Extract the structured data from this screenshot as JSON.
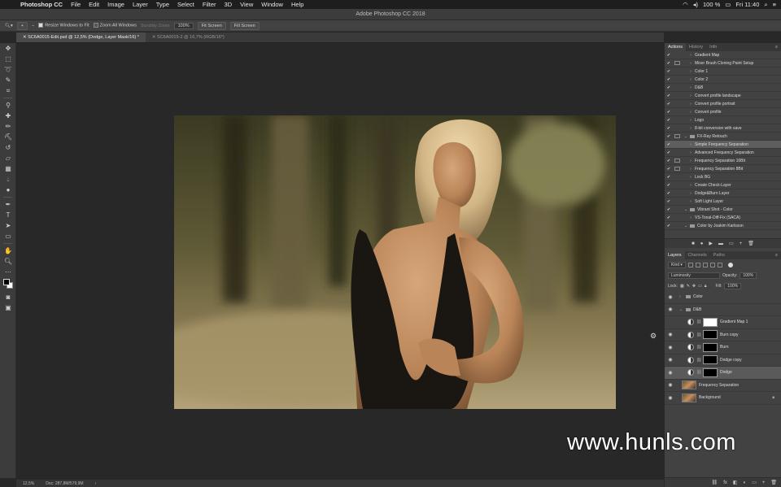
{
  "menubar": {
    "items": [
      "Photoshop CC",
      "File",
      "Edit",
      "Image",
      "Layer",
      "Type",
      "Select",
      "Filter",
      "3D",
      "View",
      "Window",
      "Help"
    ],
    "battery": "100 %",
    "clock": "Fri 11:40"
  },
  "window": {
    "title": "Adobe Photoshop CC 2018"
  },
  "options": {
    "resize_windows": "Resize Windows to Fit",
    "zoom_all": "Zoom All Windows",
    "scrubby_zoom": "Scrubby Zoom",
    "zoom_value": "100%",
    "fit_screen": "Fit Screen",
    "fill_screen": "Fill Screen"
  },
  "tabs": [
    {
      "label": "SC6A0015-Edit.psd @ 12,5% (Dodge, Layer Mask/16) *"
    },
    {
      "label": "SC6A0015-2 @ 16,7% (RGB/16*)"
    }
  ],
  "status": {
    "zoom": "12,5%",
    "doc": "Doc: 287,8M/579,9M"
  },
  "actions_panel": {
    "tabs": [
      "Actions",
      "History",
      "Info"
    ],
    "items": [
      {
        "label": "Gradient Map",
        "dialog": false,
        "kind": "action",
        "indent": 1
      },
      {
        "label": "Mixer Brush Cloning Paint Setup",
        "dialog": true,
        "kind": "action",
        "indent": 1
      },
      {
        "label": "Color 1",
        "dialog": false,
        "kind": "action",
        "indent": 1
      },
      {
        "label": "Color 2",
        "dialog": false,
        "kind": "action",
        "indent": 1
      },
      {
        "label": "D&B",
        "dialog": false,
        "kind": "action",
        "indent": 1
      },
      {
        "label": "Convert profile landscape",
        "dialog": false,
        "kind": "action",
        "indent": 1
      },
      {
        "label": "Convert profile portrait",
        "dialog": false,
        "kind": "action",
        "indent": 1
      },
      {
        "label": "Convert profile",
        "dialog": false,
        "kind": "action",
        "indent": 1
      },
      {
        "label": "Logo",
        "dialog": false,
        "kind": "action",
        "indent": 1
      },
      {
        "label": "8-bit conversion with save",
        "dialog": false,
        "kind": "action",
        "indent": 1
      },
      {
        "label": "FX-Ray Retouch",
        "dialog": true,
        "kind": "set",
        "indent": 0
      },
      {
        "label": "Simple Frequency Separation",
        "dialog": false,
        "kind": "action",
        "indent": 1,
        "selected": true
      },
      {
        "label": "Advanced Frequency Separation",
        "dialog": false,
        "kind": "action",
        "indent": 1
      },
      {
        "label": "Frequency Separation 16Bit",
        "dialog": true,
        "kind": "action",
        "indent": 1
      },
      {
        "label": "Frequency Separation 8Bit",
        "dialog": true,
        "kind": "action",
        "indent": 1
      },
      {
        "label": "Lock BG",
        "dialog": false,
        "kind": "action",
        "indent": 1
      },
      {
        "label": "Create Check-Layer",
        "dialog": false,
        "kind": "action",
        "indent": 1
      },
      {
        "label": "Dodge&Burn Layer",
        "dialog": false,
        "kind": "action",
        "indent": 1
      },
      {
        "label": "Soft Light Layer",
        "dialog": false,
        "kind": "action",
        "indent": 1
      },
      {
        "label": "Vibrant Shot - Color",
        "dialog": false,
        "kind": "set",
        "indent": 0
      },
      {
        "label": "VS-Tonal-Diff-Fix (SACA)",
        "dialog": false,
        "kind": "action",
        "indent": 1
      },
      {
        "label": "Color by Joakim Karlsson",
        "dialog": false,
        "kind": "set",
        "indent": 0
      }
    ],
    "footer": [
      "■",
      "●",
      "▶",
      "▬",
      "▭",
      "+",
      "🗑"
    ]
  },
  "layers_panel": {
    "tabs": [
      "Layers",
      "Channels",
      "Paths"
    ],
    "filter": "Kind",
    "blend_mode": "Luminosity",
    "opacity_label": "Opacity:",
    "opacity": "100%",
    "lock_label": "Lock:",
    "fill_label": "Fill:",
    "fill": "100%",
    "layers": [
      {
        "name": "Color",
        "type": "group",
        "visible": true,
        "indent": 0
      },
      {
        "name": "D&B",
        "type": "group-open",
        "visible": true,
        "indent": 0
      },
      {
        "name": "Gradient Map 1",
        "type": "adjust",
        "mask": "white",
        "visible": false,
        "indent": 1
      },
      {
        "name": "Burn copy",
        "type": "adjust",
        "mask": "black",
        "visible": true,
        "indent": 1
      },
      {
        "name": "Burn",
        "type": "adjust",
        "mask": "black",
        "visible": true,
        "indent": 1
      },
      {
        "name": "Dodge copy",
        "type": "adjust",
        "mask": "black",
        "visible": true,
        "indent": 1
      },
      {
        "name": "Dodge",
        "type": "adjust",
        "mask": "black",
        "visible": true,
        "indent": 1,
        "selected": true
      },
      {
        "name": "Frequency Separation",
        "type": "pixel",
        "visible": true,
        "indent": 0
      },
      {
        "name": "Background",
        "type": "pixel",
        "visible": true,
        "indent": 0,
        "locked": true
      }
    ],
    "footer": [
      "⛓",
      "fx",
      "◧",
      "◐",
      "▭",
      "+",
      "🗑"
    ]
  },
  "watermark": "www.hunls.com"
}
